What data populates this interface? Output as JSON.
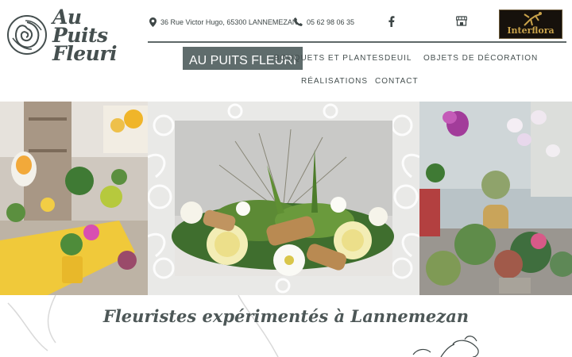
{
  "logo": {
    "line1": "Au Puits",
    "line2": "Fleuri",
    "icon": "rose-icon"
  },
  "contact": {
    "address": "36 Rue Victor Hugo, 65300 LANNEMEZAN",
    "phone": "05 62 98 06 35",
    "address_icon": "map-pin-icon",
    "phone_icon": "phone-icon"
  },
  "social": {
    "facebook_icon": "facebook-icon",
    "shop_icon": "storefront-icon"
  },
  "partner": {
    "name": "Interflora"
  },
  "nav": {
    "items": [
      {
        "label": "AU PUITS FLEURI",
        "active": true
      },
      {
        "label": "BOUQUETS ET PLANTES"
      },
      {
        "label": "DEUIL"
      },
      {
        "label": "OBJETS DE DÉCORATION"
      },
      {
        "label": "RÉALISATIONS"
      },
      {
        "label": "CONTACT"
      }
    ]
  },
  "tagline": "Fleuristes expérimentés à Lannemezan",
  "colors": {
    "text": "#454f4f",
    "active_nav": "#5f6c6c",
    "rule": "#5f6868"
  }
}
